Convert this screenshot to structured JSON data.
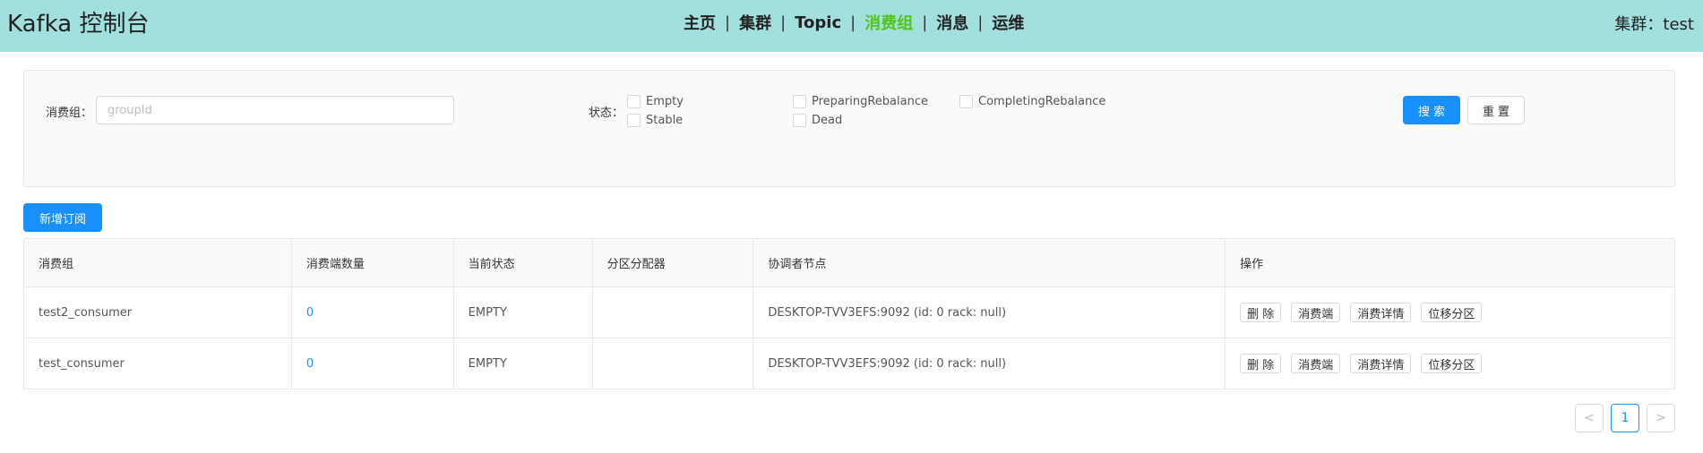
{
  "header": {
    "title": "Kafka 控制台",
    "nav": [
      "主页",
      "集群",
      "Topic",
      "消费组",
      "消息",
      "运维"
    ],
    "nav_active": "消费组",
    "nav_separator": "|",
    "cluster_label": "集群：test"
  },
  "filter": {
    "group_label": "消费组：",
    "group_placeholder": "groupId",
    "group_value": "",
    "status_label": "状态：",
    "statuses": [
      "Empty",
      "Stable",
      "PreparingRebalance",
      "Dead",
      "CompletingRebalance"
    ],
    "search_label": "搜 索",
    "reset_label": "重 置"
  },
  "add_subscription_label": "新增订阅",
  "table": {
    "columns": [
      "消费组",
      "消费端数量",
      "当前状态",
      "分区分配器",
      "协调者节点",
      "操作"
    ],
    "rows": [
      {
        "group": "test2_consumer",
        "members": "0",
        "state": "EMPTY",
        "assignor": "",
        "coordinator": "DESKTOP-TVV3EFS:9092 (id: 0 rack: null)"
      },
      {
        "group": "test_consumer",
        "members": "0",
        "state": "EMPTY",
        "assignor": "",
        "coordinator": "DESKTOP-TVV3EFS:9092 (id: 0 rack: null)"
      }
    ],
    "actions": [
      "删 除",
      "消费端",
      "消费详情",
      "位移分区"
    ]
  },
  "pagination": {
    "prev": "<",
    "current_page": "1",
    "next": ">"
  },
  "colors": {
    "header_bg": "#a2e0e0",
    "nav_active": "#52c41a",
    "primary": "#1890ff"
  }
}
